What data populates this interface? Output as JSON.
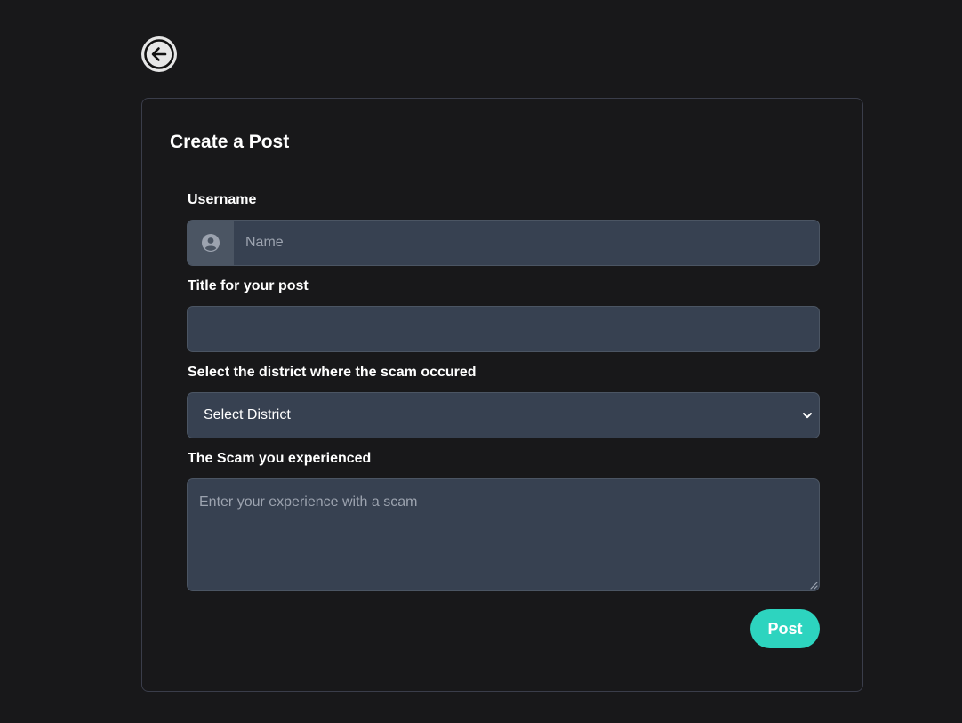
{
  "nav": {
    "back_icon": "arrow-left-circle-icon"
  },
  "form": {
    "title": "Create a Post",
    "username": {
      "label": "Username",
      "placeholder": "Name",
      "value": "",
      "icon": "user-circle-icon"
    },
    "post_title": {
      "label": "Title for your post",
      "placeholder": "",
      "value": ""
    },
    "district": {
      "label": "Select the district where the scam occured",
      "selected": "Select District",
      "icon": "chevron-down-icon"
    },
    "experience": {
      "label": "The Scam you experienced",
      "placeholder": "Enter your experience with a scam",
      "value": ""
    },
    "submit_label": "Post"
  },
  "colors": {
    "background": "#18181a",
    "input_background": "#374151",
    "addon_background": "#4b5563",
    "accent": "#2dd4bf"
  }
}
